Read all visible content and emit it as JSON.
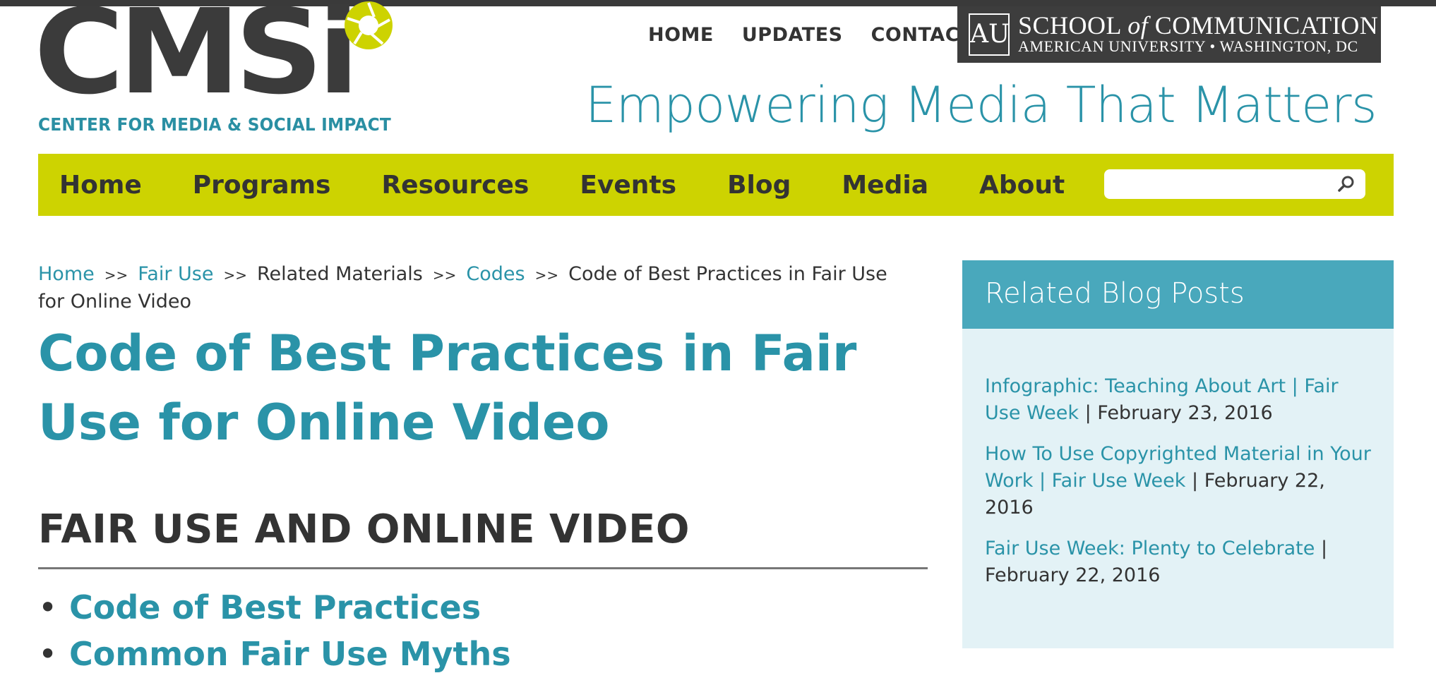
{
  "logo": {
    "wordmark": "CMSi",
    "tagline": "CENTER FOR MEDIA & SOCIAL IMPACT",
    "accent_color": "#cdd301"
  },
  "top_nav": [
    {
      "label": "HOME"
    },
    {
      "label": "UPDATES"
    },
    {
      "label": "CONTACT"
    }
  ],
  "school_badge": {
    "emblem": "AU",
    "line1_a": "SCHOOL ",
    "line1_of": "of",
    "line1_b": " COMMUNICATION",
    "line2": "AMERICAN UNIVERSITY • WASHINGTON, DC"
  },
  "slogan": "Empowering Media That Matters",
  "main_nav": {
    "items": [
      {
        "label": "Home"
      },
      {
        "label": "Programs"
      },
      {
        "label": "Resources"
      },
      {
        "label": "Events"
      },
      {
        "label": "Blog"
      },
      {
        "label": "Media"
      },
      {
        "label": "About"
      }
    ],
    "search_placeholder": "",
    "bar_color": "#cdd301"
  },
  "breadcrumb": {
    "items": [
      {
        "label": "Home",
        "link": true
      },
      {
        "label": "Fair Use",
        "link": true
      },
      {
        "label": "Related Materials",
        "link": false
      },
      {
        "label": "Codes",
        "link": true
      },
      {
        "label": "Code of Best Practices in Fair Use for Online Video",
        "link": false
      }
    ],
    "separator": ">>"
  },
  "page_title": "Code of Best Practices in Fair Use for Online Video",
  "section_heading": "FAIR USE AND ONLINE VIDEO",
  "toc": [
    {
      "label": "Code of Best Practices"
    },
    {
      "label": "Common Fair Use Myths"
    }
  ],
  "sidebar": {
    "title": "Related Blog Posts",
    "posts": [
      {
        "title": "Infographic: Teaching About Art | Fair Use Week",
        "date": "February 23, 2016"
      },
      {
        "title": "How To Use Copyrighted Material in Your Work | Fair Use Week",
        "date": "February 22, 2016"
      },
      {
        "title": "Fair Use Week: Plenty to Celebrate",
        "date": "February 22, 2016"
      }
    ]
  },
  "colors": {
    "teal": "#2a93a8",
    "sidebar_header": "#49a8bc",
    "sidebar_bg": "#e3f2f6",
    "dark": "#3b3b3b"
  }
}
